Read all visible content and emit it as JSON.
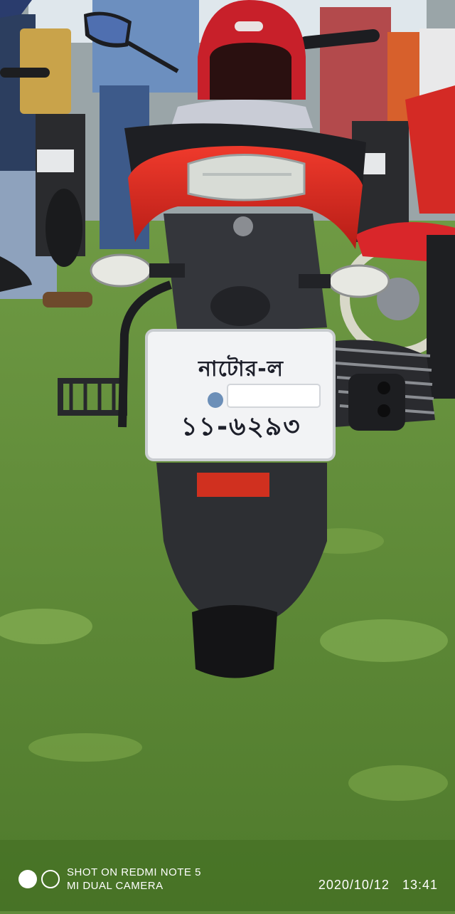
{
  "plate": {
    "line1": "নাটোর-ল",
    "line2": "১১-৬২৯৩"
  },
  "watermark": {
    "line1": "SHOT ON REDMI NOTE 5",
    "line2": "MI DUAL CAMERA"
  },
  "timestamp": {
    "date": "2020/10/12",
    "time": "13:41"
  },
  "colors": {
    "grass": "#5f8a3a",
    "bike_red": "#d7261f",
    "plate": "#f2f3f5",
    "helmet_red": "#c8202a"
  }
}
